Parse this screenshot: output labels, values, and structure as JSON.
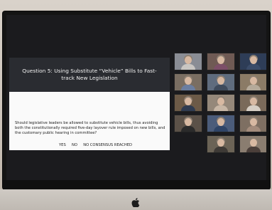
{
  "slide": {
    "title": "Question 5:  Using Substitute “Vehicle” Bills to Fast-track New Legislation",
    "body": "Should legislative leaders be allowed to substitute vehicle bills, thus avoiding both the constitutionally required five-day layover rule imposed on new bills, and the customary public hearing in committee?",
    "answers": "YES     NO     NO CONSENSUS REACHED"
  },
  "gallery": {
    "participants": [
      {
        "bg": "#8a8d95",
        "body": "#c9c6c2"
      },
      {
        "bg": "#6f5a54",
        "body": "#7c4f68"
      },
      {
        "bg": "#2e3d57",
        "body": "#3b4c69"
      },
      {
        "bg": "#7a6e62",
        "body": "#6b7ea0"
      },
      {
        "bg": "#5f6c7e",
        "body": "#3f4b5c"
      },
      {
        "bg": "#8b7b66",
        "body": "#b5aa9a"
      },
      {
        "bg": "#6c5a47",
        "body": "#2f3b50"
      },
      {
        "bg": "#95887a",
        "body": "#c8b7a6"
      },
      {
        "bg": "#7a6a5a",
        "body": "#d7cfc5"
      },
      {
        "bg": "#5b5148",
        "body": "#2b2b2b"
      },
      {
        "bg": "#4b5c7a",
        "body": "#2f4466"
      },
      {
        "bg": "#7e6f62",
        "body": "#a48c7c"
      },
      {
        "bg": "#6b6356",
        "body": "#3e3a36"
      },
      {
        "bg": "#8a7d70",
        "body": "#4b3f3a"
      },
      {
        "bg": "#9b8f84",
        "body": "#e3ddd6"
      },
      {
        "bg": "#7b6a5c",
        "body": "#5a3f3f"
      }
    ]
  }
}
